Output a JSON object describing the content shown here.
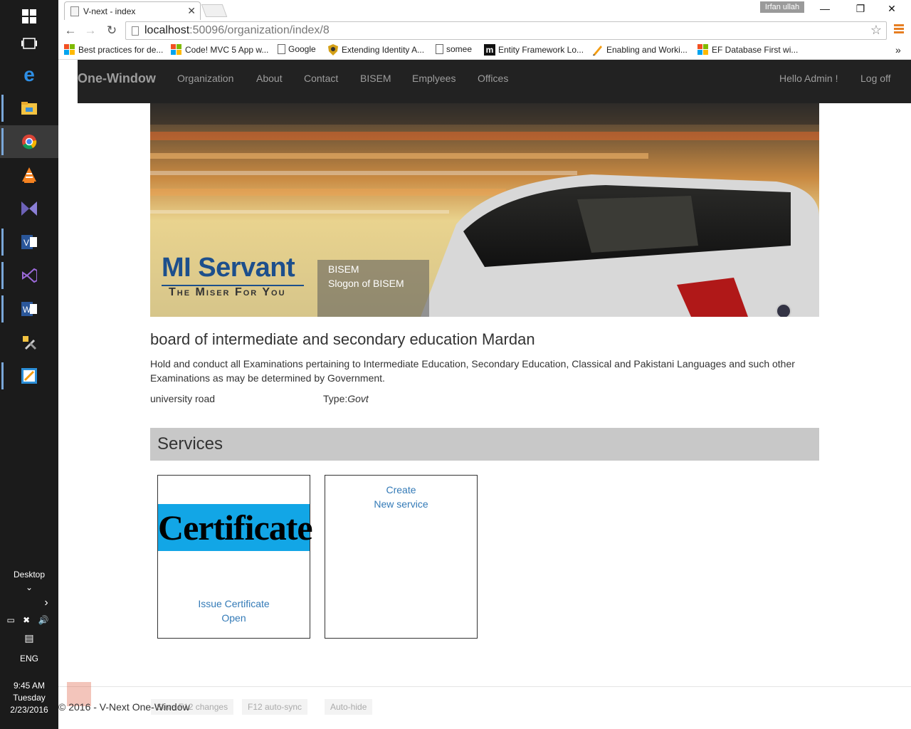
{
  "taskbar": {
    "desktop_label": "Desktop",
    "language": "ENG",
    "time": "9:45 AM",
    "day": "Tuesday",
    "date": "2/23/2016"
  },
  "browser": {
    "tab_title": "V-next - index",
    "user_badge": "Irfan ullah",
    "url_host": "localhost",
    "url_rest": ":50096/organization/index/8",
    "bookmarks": [
      {
        "label": "Best practices for de...",
        "icon": "ms-icon"
      },
      {
        "label": "Code! MVC 5 App w...",
        "icon": "ms-icon"
      },
      {
        "label": "Google",
        "icon": "page-icon"
      },
      {
        "label": "Extending Identity A...",
        "icon": "shield-icon"
      },
      {
        "label": "somee",
        "icon": "page-icon"
      },
      {
        "label": "Entity Framework Lo...",
        "icon": "m-icon"
      },
      {
        "label": "Enabling and Worki...",
        "icon": "pen-icon"
      },
      {
        "label": "EF Database First wi...",
        "icon": "ms-icon"
      }
    ]
  },
  "site": {
    "brand": "One-Window",
    "nav": [
      "Organization",
      "About",
      "Contact",
      "BISEM",
      "Emplyees",
      "Offices"
    ],
    "greeting": "Hello Admin !",
    "logoff": "Log off",
    "hero": {
      "caption_title": "BISEM",
      "caption_slogan": "Slogon of BISEM",
      "logo_title": "MI Servant",
      "logo_subtitle": "The Miser For You"
    },
    "org": {
      "title": "board of intermediate and secondary education Mardan",
      "description": "Hold and conduct all Examinations pertaining to Intermediate Education, Secondary Education, Classical and Pakistani Languages and such other Examinations as may be determined by Government.",
      "address": "university road",
      "type_label": "Type:",
      "type_value": "Govt"
    },
    "services": {
      "header": "Services",
      "cards": [
        {
          "image_text": "Certificate",
          "link1": "Issue Certificate",
          "link2": "Open"
        },
        {
          "link1": "Create",
          "link2": "New service"
        }
      ]
    },
    "footer": "© 2016 - V-Next One-Window"
  },
  "vs_bar": {
    "items": [
      "Save F12 changes",
      "F12 auto-sync",
      "Auto-hide"
    ]
  }
}
